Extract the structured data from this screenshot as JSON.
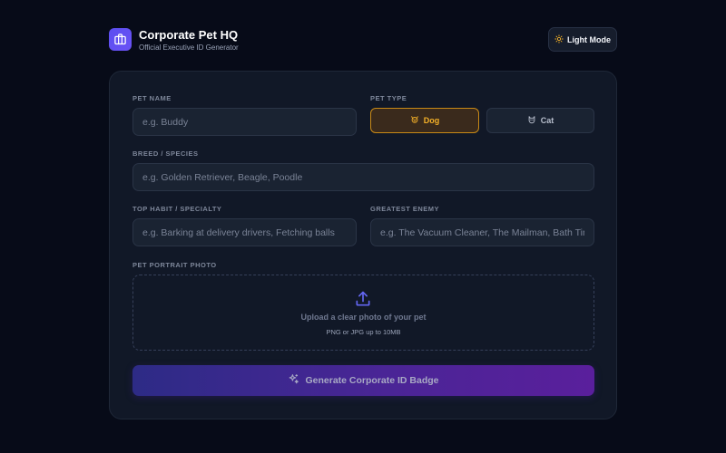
{
  "header": {
    "title": "Corporate Pet HQ",
    "subtitle": "Official Executive ID Generator",
    "mode_toggle_label": "Light Mode"
  },
  "form": {
    "pet_name": {
      "label": "PET NAME",
      "value": "",
      "placeholder": "e.g. Buddy"
    },
    "pet_type": {
      "label": "PET TYPE",
      "options": [
        "Dog",
        "Cat"
      ],
      "selected": "Dog"
    },
    "breed": {
      "label": "BREED / SPECIES",
      "value": "",
      "placeholder": "e.g. Golden Retriever, Beagle, Poodle"
    },
    "habit": {
      "label": "TOP HABIT / SPECIALTY",
      "value": "",
      "placeholder": "e.g. Barking at delivery drivers, Fetching balls"
    },
    "enemy": {
      "label": "GREATEST ENEMY",
      "value": "",
      "placeholder": "e.g. The Vacuum Cleaner, The Mailman, Bath Time"
    },
    "photo": {
      "label": "PET PORTRAIT PHOTO",
      "prompt": "Upload a clear photo of your pet",
      "hint": "PNG or JPG up to 10MB"
    },
    "submit_label": "Generate Corporate ID Badge"
  },
  "icons": {
    "logo": "briefcase-icon",
    "mode_toggle": "sun-icon",
    "dog": "dog-icon",
    "cat": "cat-icon",
    "upload": "upload-icon",
    "generate": "sparkles-icon"
  },
  "colors": {
    "background": "#070b18",
    "card": "#111827",
    "accent": "#5b4ef0",
    "selected_type": "#f5b128"
  }
}
